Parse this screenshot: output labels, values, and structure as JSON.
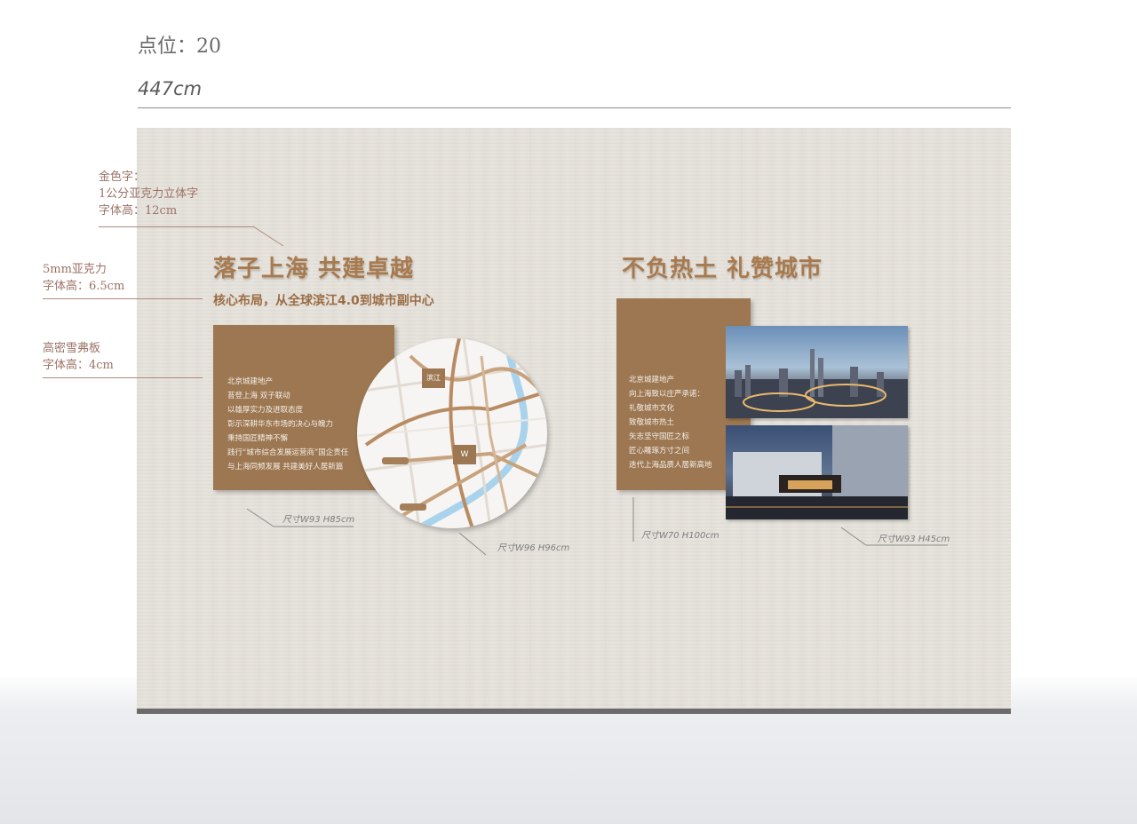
{
  "header": {
    "point_label": "点位：20",
    "width_label": "447cm"
  },
  "notes": {
    "gold_text": [
      "金色字：",
      "1公分亚克力立体字",
      "字体高：12cm"
    ],
    "acrylic": [
      "5mm亚克力",
      "字体高：6.5cm"
    ],
    "board": [
      "高密雪弗板",
      "字体高：4cm"
    ]
  },
  "left_section": {
    "title": "落子上海  共建卓越",
    "subtitle": "核心布局，从全球滨江4.0到城市副中心",
    "panel_lines": [
      "北京城建地产",
      "苔登上海 双子联动",
      "以雄厚实力及进取态度",
      "彰示深耕华东市场的决心与魄力",
      "秉持国匠精神不懈",
      "践行“城市综合发展运营商”国企责任",
      "与上海同频发展 共建美好人居新篇"
    ],
    "panel_dim": "尺寸W93  H85cm",
    "map_dim": "尺寸W96  H96cm",
    "map_marker": "滨江"
  },
  "right_section": {
    "title": "不负热土  礼赞城市",
    "panel_lines": [
      "北京城建地产",
      "向上海致以庄严承诺：",
      "礼敬城市文化",
      "致敬城市热土",
      "矢志坚守国匠之标",
      "匠心雕琢方寸之间",
      "迭代上海品质人居新高地"
    ],
    "panel_dim": "尺寸W70  H100cm",
    "photo_dim": "尺寸W93  H45cm"
  },
  "colors": {
    "accent_gold": "#a87a4e",
    "panel_brown": "#9c7752",
    "note_text": "#9a7266",
    "wall": "#e6e2db"
  }
}
